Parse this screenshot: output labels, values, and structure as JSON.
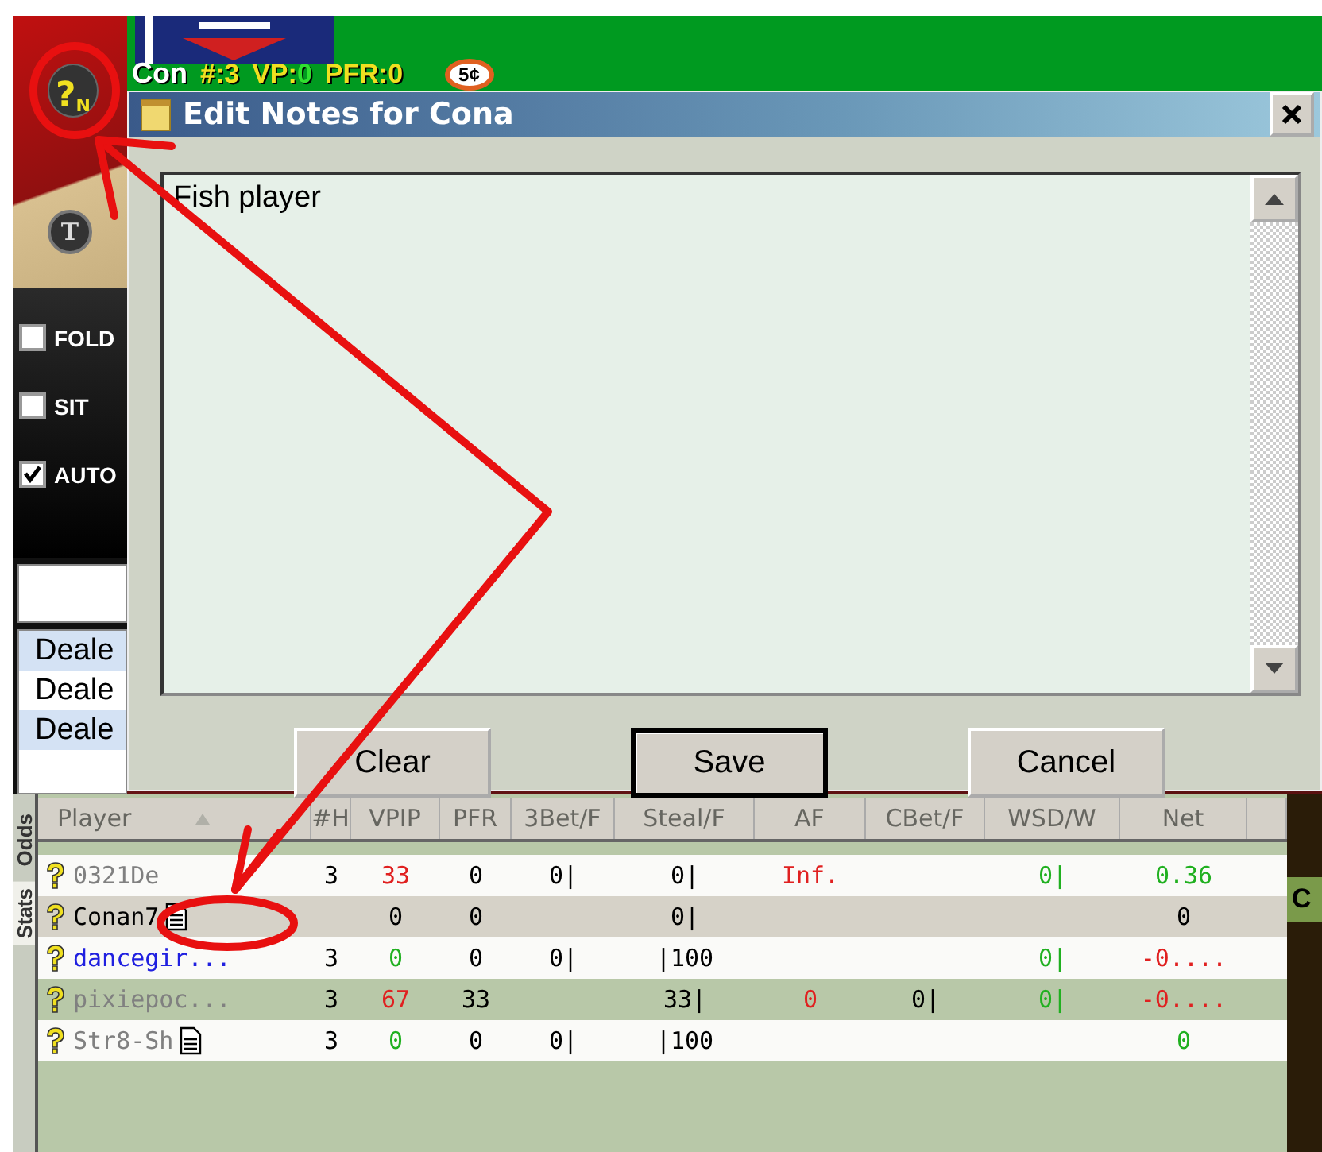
{
  "seat": {
    "badge": {
      "mark": "?",
      "sub": "N"
    },
    "dealer_button": "T",
    "player": "Con",
    "hud": [
      {
        "label": "#:",
        "value": "3",
        "color": "#f0e020"
      },
      {
        "label": "VP:",
        "value": "0",
        "color": "#30e030"
      },
      {
        "label": "PFR:",
        "value": "0",
        "color": "#f0e020"
      }
    ],
    "chip": "5¢"
  },
  "actions": [
    {
      "label": "FOLD",
      "checked": false
    },
    {
      "label": "SIT",
      "checked": false
    },
    {
      "label": "AUTO",
      "checked": true
    }
  ],
  "chat_lines": [
    "Deale",
    "Deale",
    "Deale"
  ],
  "dialog": {
    "title": "Edit Notes for Cona",
    "notes": "Fish player",
    "buttons": [
      {
        "label": "Clear",
        "default": false
      },
      {
        "label": "Save",
        "default": true
      },
      {
        "label": "Cancel",
        "default": false
      }
    ]
  },
  "side_tabs": [
    {
      "label": "Odds",
      "selected": false
    },
    {
      "label": "Stats",
      "selected": true
    }
  ],
  "stats": {
    "columns": [
      {
        "label": "Player",
        "sorted": true
      },
      {
        "label": "#H",
        "sorted": false
      },
      {
        "label": "VPIP",
        "sorted": false
      },
      {
        "label": "PFR",
        "sorted": false
      },
      {
        "label": "3Bet/F",
        "sorted": false
      },
      {
        "label": "Steal/F",
        "sorted": false
      },
      {
        "label": "AF",
        "sorted": false
      },
      {
        "label": "CBet/F",
        "sorted": false
      },
      {
        "label": "WSD/W",
        "sorted": false
      },
      {
        "label": "Net",
        "sorted": false
      }
    ],
    "rows": [
      {
        "selected": false,
        "has_note": false,
        "cells": [
          {
            "text": "0321De",
            "color": "#808080"
          },
          {
            "text": "3",
            "color": "#000000"
          },
          {
            "text": "33",
            "color": "#e02020"
          },
          {
            "text": "0",
            "color": "#000000"
          },
          {
            "text": "0|",
            "color": "#000000"
          },
          {
            "text": "0|",
            "color": "#000000"
          },
          {
            "text": "Inf.",
            "color": "#e02020"
          },
          null,
          {
            "text": "0|",
            "color": "#20b020"
          },
          {
            "text": "0.36",
            "color": "#20b020"
          }
        ]
      },
      {
        "selected": true,
        "has_note": true,
        "cells": [
          {
            "text": "Conan7",
            "color": "#000000"
          },
          null,
          {
            "text": "0",
            "color": "#000000"
          },
          {
            "text": "0",
            "color": "#000000"
          },
          null,
          {
            "text": "0|",
            "color": "#000000"
          },
          null,
          null,
          null,
          {
            "text": "0",
            "color": "#000000"
          }
        ]
      },
      {
        "selected": false,
        "has_note": false,
        "cells": [
          {
            "text": "dancegir...",
            "color": "#2020e0"
          },
          {
            "text": "3",
            "color": "#000000"
          },
          {
            "text": "0",
            "color": "#20b020"
          },
          {
            "text": "0",
            "color": "#000000"
          },
          {
            "text": "0|",
            "color": "#000000"
          },
          {
            "text": "|100",
            "color": "#000000"
          },
          null,
          null,
          {
            "text": "0|",
            "color": "#20b020"
          },
          {
            "text": "-0....",
            "color": "#e02020"
          }
        ]
      },
      {
        "selected": false,
        "has_note": false,
        "cells": [
          {
            "text": "pixiepoc...",
            "color": "#808080"
          },
          {
            "text": "3",
            "color": "#000000"
          },
          {
            "text": "67",
            "color": "#e02020"
          },
          {
            "text": "33",
            "color": "#000000"
          },
          null,
          {
            "text": "33|",
            "color": "#000000"
          },
          {
            "text": "0",
            "color": "#e02020"
          },
          {
            "text": "0|",
            "color": "#000000"
          },
          {
            "text": "0|",
            "color": "#20b020"
          },
          {
            "text": "-0....",
            "color": "#e02020"
          }
        ]
      },
      {
        "selected": false,
        "has_note": true,
        "cells": [
          {
            "text": "Str8-Sh",
            "color": "#808080"
          },
          {
            "text": "3",
            "color": "#000000"
          },
          {
            "text": "0",
            "color": "#20b020"
          },
          {
            "text": "0",
            "color": "#000000"
          },
          {
            "text": "0|",
            "color": "#000000"
          },
          {
            "text": "|100",
            "color": "#000000"
          },
          null,
          null,
          null,
          {
            "text": "0",
            "color": "#20b020"
          }
        ]
      }
    ]
  },
  "side_panel_label": "C"
}
